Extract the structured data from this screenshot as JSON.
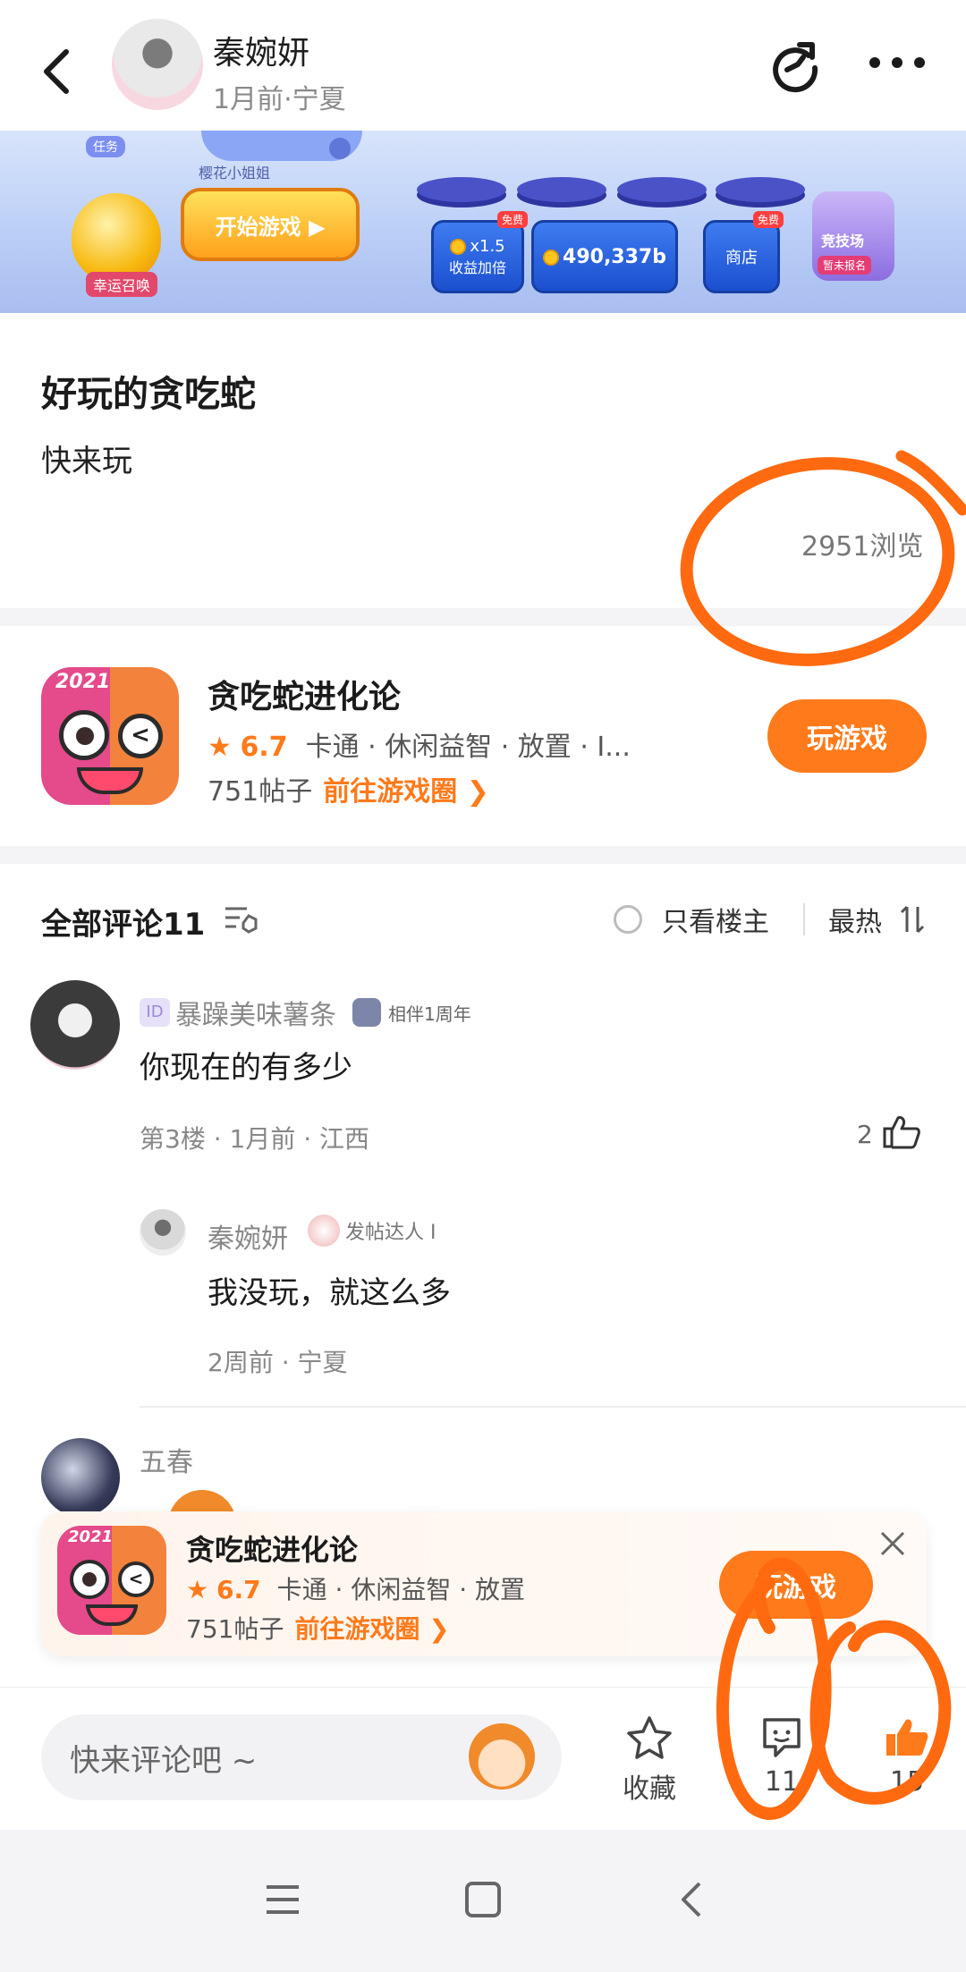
{
  "header": {
    "author_name": "秦婉妍",
    "author_meta": "1月前·宁夏"
  },
  "banner": {
    "task_label": "任务",
    "pod_label": "樱花小姐姐",
    "lucky_label": "幸运召唤",
    "start_button": "开始游戏 ▶",
    "free_tag": "免费",
    "boost_value": "x1.5",
    "boost_label": "收益加倍",
    "coins": "490,337b",
    "shop_label": "商店",
    "arena_label": "竞技场",
    "arena_status": "暂未报名"
  },
  "post": {
    "title": "好玩的贪吃蛇",
    "body": "快来玩",
    "views": "2951浏览"
  },
  "game": {
    "icon_year": "2021",
    "name": "贪吃蛇进化论",
    "rating": "6.7",
    "tags": "卡通 · 休闲益智 · 放置 · I...",
    "posts": "751帖子",
    "goto": "前往游戏圈 ❯",
    "play": "玩游戏"
  },
  "comments": {
    "header": "全部评论11",
    "only_host": "只看楼主",
    "sort": "最热",
    "items": [
      {
        "id_tag": "ID",
        "user": "暴躁美味薯条",
        "badge": "相伴1周年",
        "text": "你现在的有多少",
        "meta": "第3楼 · 1月前 · 江西",
        "likes": "2"
      }
    ],
    "reply": {
      "user": "秦婉妍",
      "badge": "发帖达人 I",
      "text": "我没玩，就这么多",
      "meta": "2周前 · 宁夏"
    },
    "third_user": "五春"
  },
  "float_banner": {
    "icon_year": "2021",
    "name": "贪吃蛇进化论",
    "rating": "6.7",
    "tags": "卡通 · 休闲益智 · 放置",
    "posts": "751帖子",
    "goto": "前往游戏圈 ❯",
    "play": "玩游戏"
  },
  "bottom_bar": {
    "comment_placeholder": "快来评论吧 ~",
    "favorite_label": "收藏",
    "comment_count": "11",
    "like_count": "15"
  },
  "colors": {
    "accent": "#ff7a1a",
    "annotation": "#ff6a10"
  },
  "icons": [
    "back-icon",
    "share-icon",
    "more-icon",
    "sort-icon",
    "like-icon",
    "star-icon",
    "comment-icon",
    "thumb-icon",
    "close-icon",
    "menu-icon",
    "home-icon",
    "nav-back-icon"
  ]
}
